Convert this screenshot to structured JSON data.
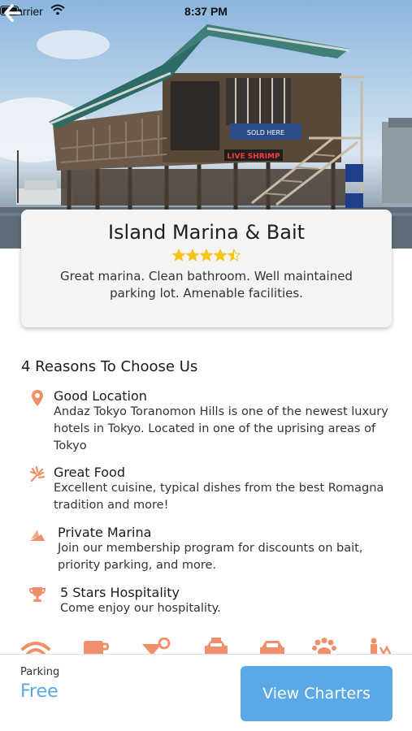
{
  "status_bar": {
    "carrier": "Carrier",
    "time": "8:37 PM"
  },
  "hero": {
    "sign_live_shrimp": "LIVE SHRIMP",
    "sign_tickets": "SOLD HERE"
  },
  "listing": {
    "name": "Island Marina & Bait",
    "rating": 4.5,
    "rating_max": 5,
    "description": "Great marina. Clean bathroom.  Well maintained parking lot. Amenable facilities."
  },
  "reasons": {
    "title": "4 Reasons To Choose Us",
    "items": [
      {
        "icon": "location-pin-icon",
        "title": "Good Location",
        "desc": "Andaz Tokyo Toranomon Hills is one of the newest luxury hotels in Tokyo. Located in one of the uprising areas of Tokyo"
      },
      {
        "icon": "food-icon",
        "title": "Great Food",
        "desc": "Excellent cuisine, typical dishes from the best Romagna tradition and more!"
      },
      {
        "icon": "boat-icon",
        "title": "Private Marina",
        "desc": "Join our membership program for discounts on bait, priority parking, and more."
      },
      {
        "icon": "trophy-icon",
        "title": "5 Stars Hospitality",
        "desc": "Come enjoy our hospitality."
      }
    ]
  },
  "amenities": [
    "wifi-icon",
    "coffee-icon",
    "cocktail-icon",
    "taxi-icon",
    "car-icon",
    "paw-icon",
    "spa-icon"
  ],
  "bottom_bar": {
    "label": "Parking",
    "value": "Free",
    "button": "View Charters"
  },
  "colors": {
    "accent_orange": "#f0906a",
    "accent_blue": "#5aa9e6",
    "star": "#f5c518"
  }
}
